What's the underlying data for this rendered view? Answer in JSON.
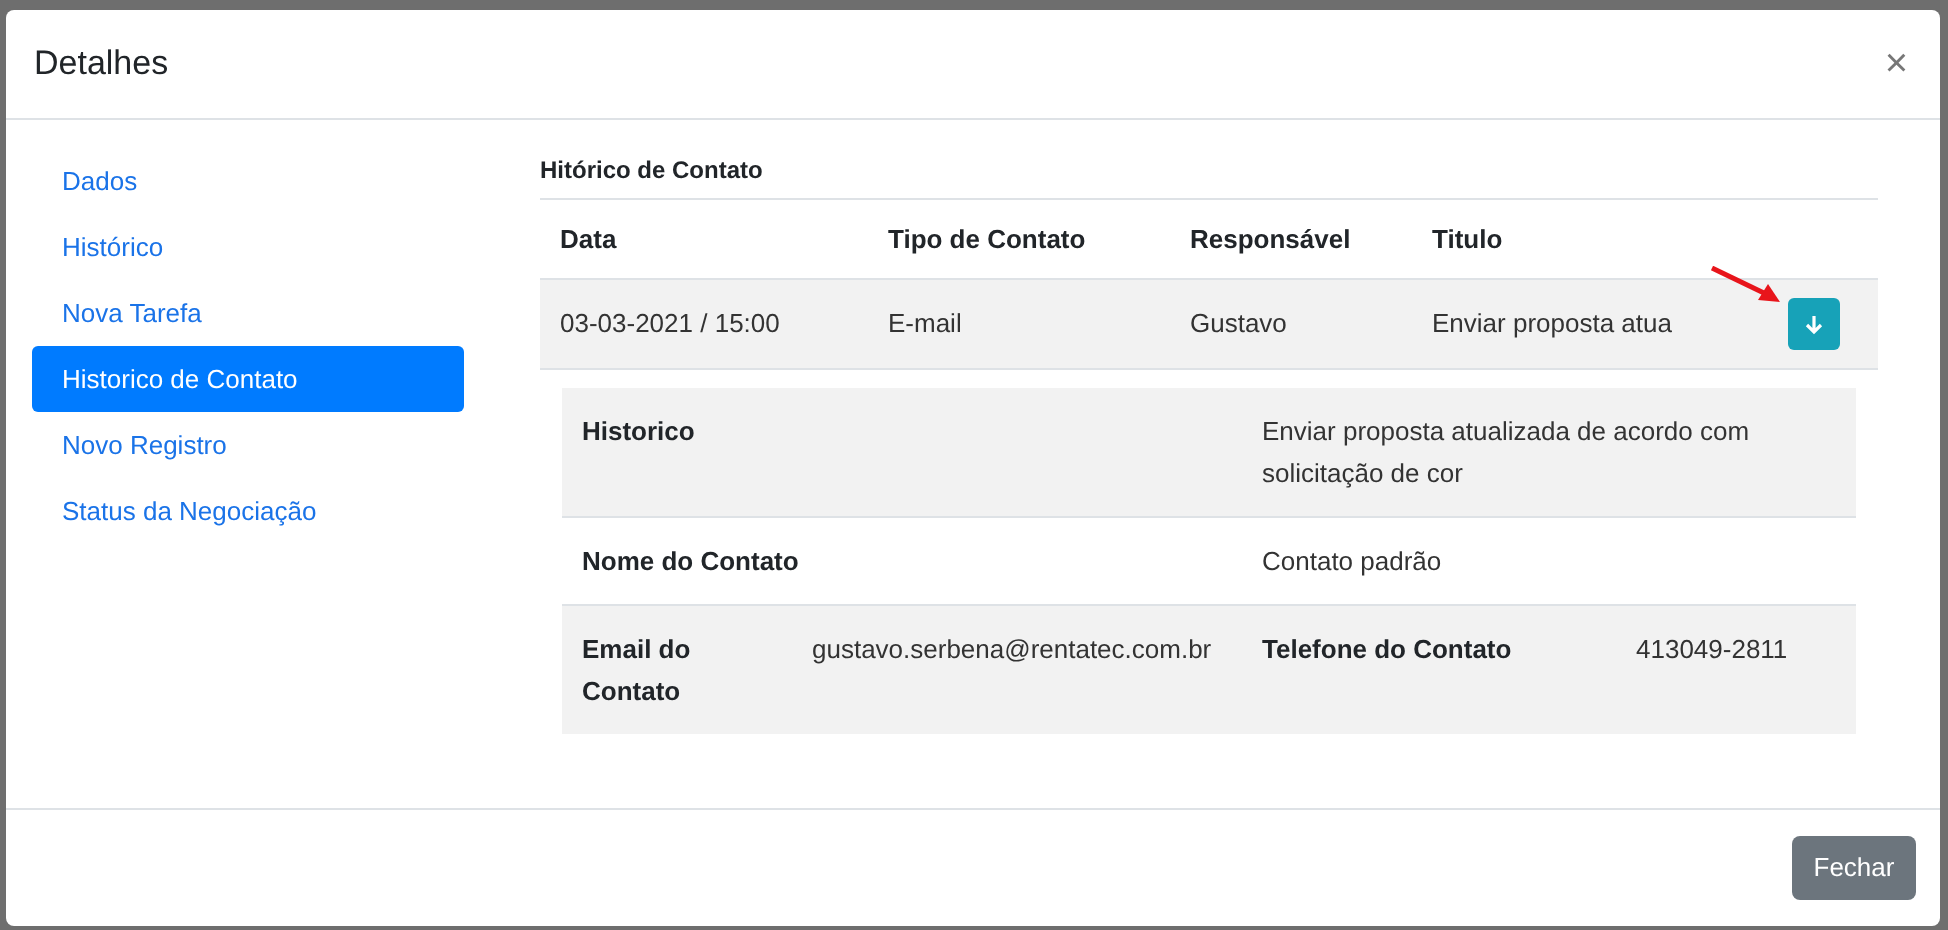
{
  "modal": {
    "title": "Detalhes",
    "close": "×"
  },
  "sidebar": {
    "items": [
      {
        "label": "Dados",
        "selected": false
      },
      {
        "label": "Histórico",
        "selected": false
      },
      {
        "label": "Nova Tarefa",
        "selected": false
      },
      {
        "label": "Historico de Contato",
        "selected": true
      },
      {
        "label": "Novo Registro",
        "selected": false
      },
      {
        "label": "Status da Negociação",
        "selected": false
      }
    ]
  },
  "section_title": "Hitórico de Contato",
  "table": {
    "columns": [
      "Data",
      "Tipo de Contato",
      "Responsável",
      "Titulo"
    ],
    "rows": [
      {
        "cells": [
          "03-03-2021 / 15:00",
          "E-mail",
          "Gustavo",
          "Enviar proposta atua"
        ],
        "expanded": true
      }
    ]
  },
  "details": [
    {
      "cells": [
        {
          "label": "Historico"
        },
        {
          "value": "Enviar proposta atualizada de acordo com solicitação de cor"
        }
      ]
    },
    {
      "cells": [
        {
          "label": "Nome do Contato"
        },
        {
          "value": "Contato padrão"
        }
      ]
    },
    {
      "cells": [
        {
          "label": "Email do Contato",
          "value": "gustavo.serbena@rentatec.com.br"
        },
        {
          "label": "Telefone do Contato",
          "value": "413049-2811"
        }
      ]
    }
  ],
  "footer": {
    "button": "Fechar"
  }
}
